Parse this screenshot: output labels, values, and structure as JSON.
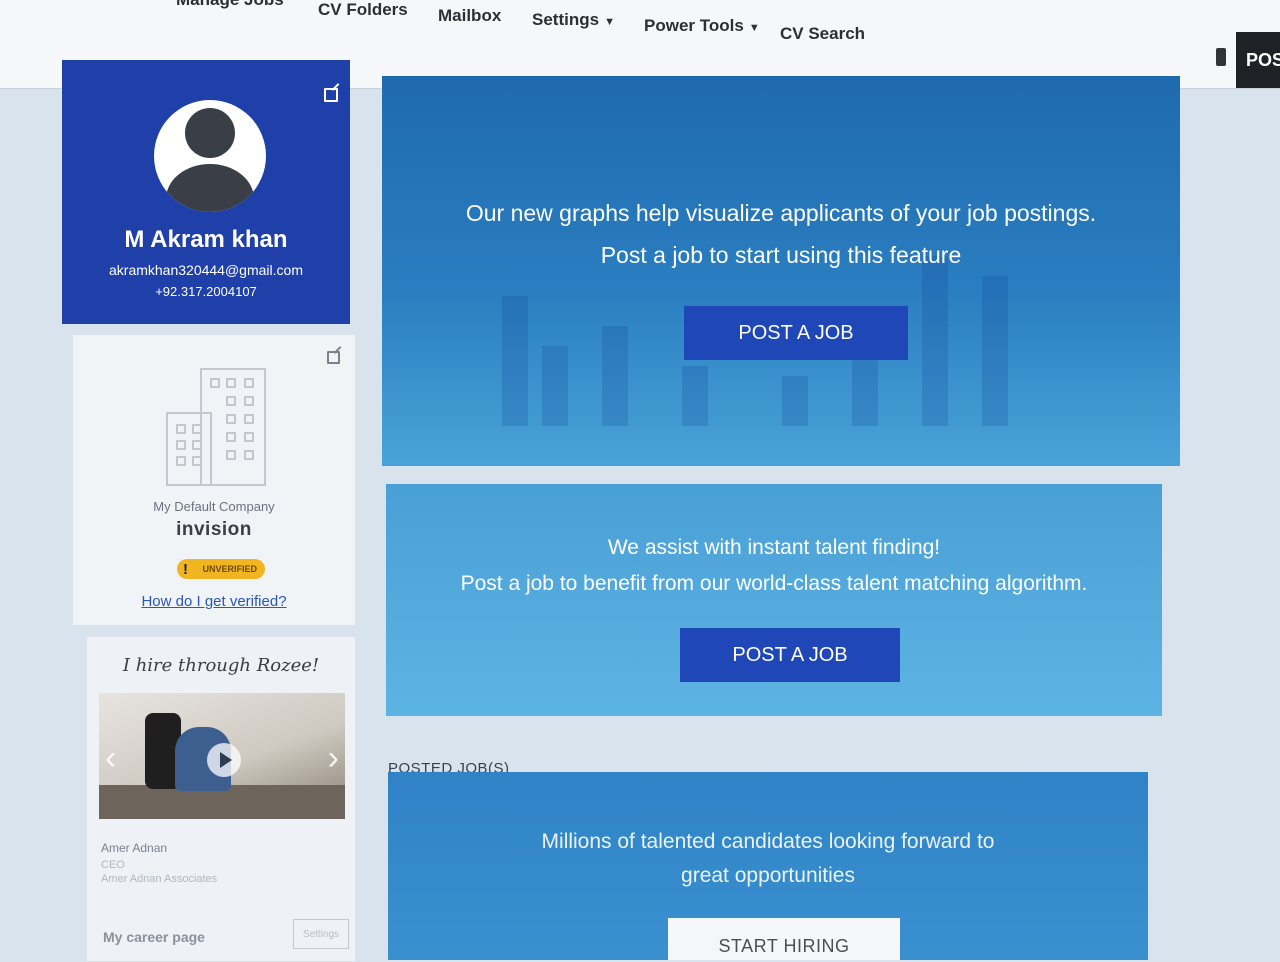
{
  "nav": {
    "items": [
      {
        "label": "Manage Jobs",
        "caret": false
      },
      {
        "label": "CV Folders",
        "caret": false
      },
      {
        "label": "Mailbox",
        "caret": false
      },
      {
        "label": "Settings",
        "caret": true
      },
      {
        "label": "Power Tools",
        "caret": true
      },
      {
        "label": "CV Search",
        "caret": false
      }
    ],
    "post_button_label": "POS"
  },
  "profile": {
    "name": "M Akram khan",
    "email": "akramkhan320444@gmail.com",
    "phone": "+92.317.2004107"
  },
  "company": {
    "label": "My Default Company",
    "name": "invision",
    "badge": "UNVERIFIED",
    "verify_link": "How do I get verified?"
  },
  "testimonial": {
    "title": "I hire through Rozee!",
    "person_name": "Amer Adnan",
    "person_role": "CEO",
    "person_company": "Amer Adnan Associates",
    "career_label": "My career page",
    "settings_label": "Settings"
  },
  "banners": {
    "graphs": {
      "line1": "Our new graphs help visualize applicants of your job postings.",
      "line2": "Post a job to start using this feature",
      "button": "POST A JOB"
    },
    "talent": {
      "line1": "We assist with instant talent finding!",
      "line2": "Post a job to benefit from our world-class talent matching algorithm.",
      "button": "POST A JOB"
    },
    "posted_label": "POSTED JOB(S)",
    "hiring": {
      "line1": "Millions of talented candidates looking forward to",
      "line2": "great opportunities",
      "button": "START HIRING"
    }
  },
  "colors": {
    "profile_bg": "#1f3fa9",
    "button_blue": "#1f47b8",
    "badge_yellow": "#f1b521"
  }
}
